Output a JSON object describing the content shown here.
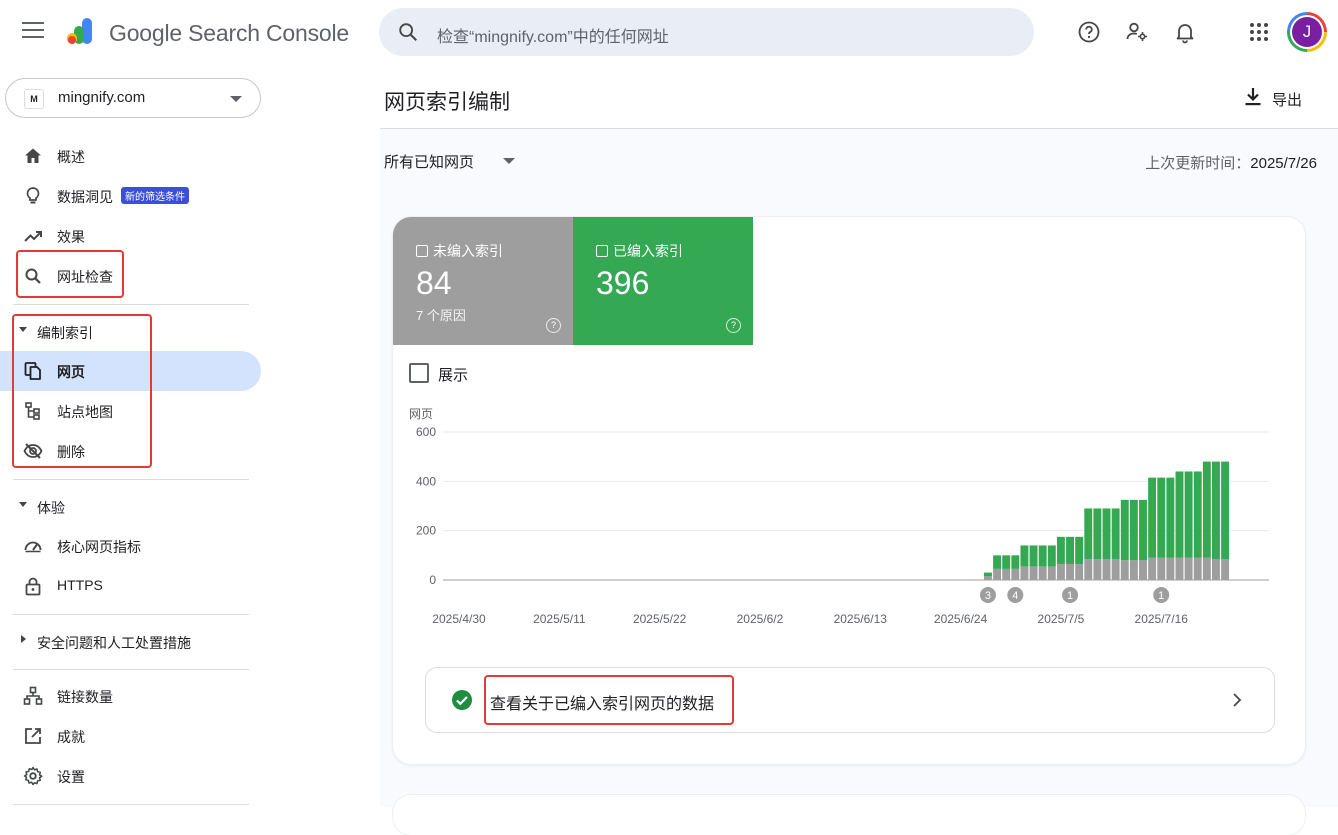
{
  "header": {
    "brand": "Google Search Console",
    "search_placeholder": "检查“mingnify.com”中的任何网址",
    "avatar_letter": "J"
  },
  "property": {
    "name": "mingnify.com",
    "favicon_letter": "M"
  },
  "sidebar": {
    "overview": "概述",
    "insights": "数据洞见",
    "insights_badge": "新的筛选条件",
    "performance": "效果",
    "url_inspection": "网址检查",
    "indexing_section": "编制索引",
    "pages": "网页",
    "sitemaps": "站点地图",
    "removals": "删除",
    "experience_section": "体验",
    "core_web_vitals": "核心网页指标",
    "https": "HTTPS",
    "security_section": "安全问题和人工处置措施",
    "links": "链接数量",
    "achievements": "成就",
    "settings": "设置"
  },
  "main": {
    "title": "网页索引编制",
    "export_label": "导出",
    "filter_label": "所有已知网页",
    "updated_label": "上次更新时间：",
    "updated_value": "2025/7/26",
    "not_indexed": {
      "label": "未编入索引",
      "value": "84",
      "sub": "7 个原因"
    },
    "indexed": {
      "label": "已编入索引",
      "value": "396"
    },
    "show_label": "展示",
    "view_data_label": "查看关于已编入索引网页的数据"
  },
  "colors": {
    "indexed_green": "#34a853",
    "not_indexed_gray": "#9e9e9e",
    "active_nav_bg": "#d3e3fd",
    "annotation_red": "#e53935"
  },
  "chart_data": {
    "type": "bar",
    "stacked": true,
    "ylabel": "网页",
    "ylim": [
      0,
      600
    ],
    "yticks": [
      0,
      200,
      400,
      600
    ],
    "x_tick_labels": [
      "2025/4/30",
      "2025/5/11",
      "2025/5/22",
      "2025/6/2",
      "2025/6/13",
      "2025/6/24",
      "2025/7/5",
      "2025/7/16"
    ],
    "categories": [
      "2025/6/27",
      "2025/6/28",
      "2025/6/29",
      "2025/6/30",
      "2025/7/1",
      "2025/7/2",
      "2025/7/3",
      "2025/7/4",
      "2025/7/5",
      "2025/7/6",
      "2025/7/7",
      "2025/7/8",
      "2025/7/9",
      "2025/7/10",
      "2025/7/11",
      "2025/7/12",
      "2025/7/13",
      "2025/7/14",
      "2025/7/15",
      "2025/7/16",
      "2025/7/17",
      "2025/7/18",
      "2025/7/19",
      "2025/7/20",
      "2025/7/21",
      "2025/7/22",
      "2025/7/23"
    ],
    "series": [
      {
        "name": "未编入索引",
        "values": [
          15,
          45,
          45,
          45,
          55,
          55,
          55,
          55,
          65,
          65,
          65,
          85,
          85,
          85,
          85,
          80,
          80,
          80,
          90,
          90,
          90,
          90,
          90,
          90,
          90,
          85,
          85
        ]
      },
      {
        "name": "已编入索引",
        "values": [
          15,
          55,
          55,
          55,
          85,
          85,
          85,
          85,
          110,
          110,
          110,
          205,
          205,
          205,
          205,
          245,
          245,
          245,
          325,
          325,
          325,
          350,
          350,
          350,
          390,
          395,
          395
        ]
      }
    ],
    "annotations": [
      {
        "x": "2025/6/27",
        "label": "3"
      },
      {
        "x": "2025/6/30",
        "label": "4"
      },
      {
        "x": "2025/7/6",
        "label": "1"
      },
      {
        "x": "2025/7/16",
        "label": "1"
      }
    ],
    "grid": true,
    "legend": "none"
  }
}
